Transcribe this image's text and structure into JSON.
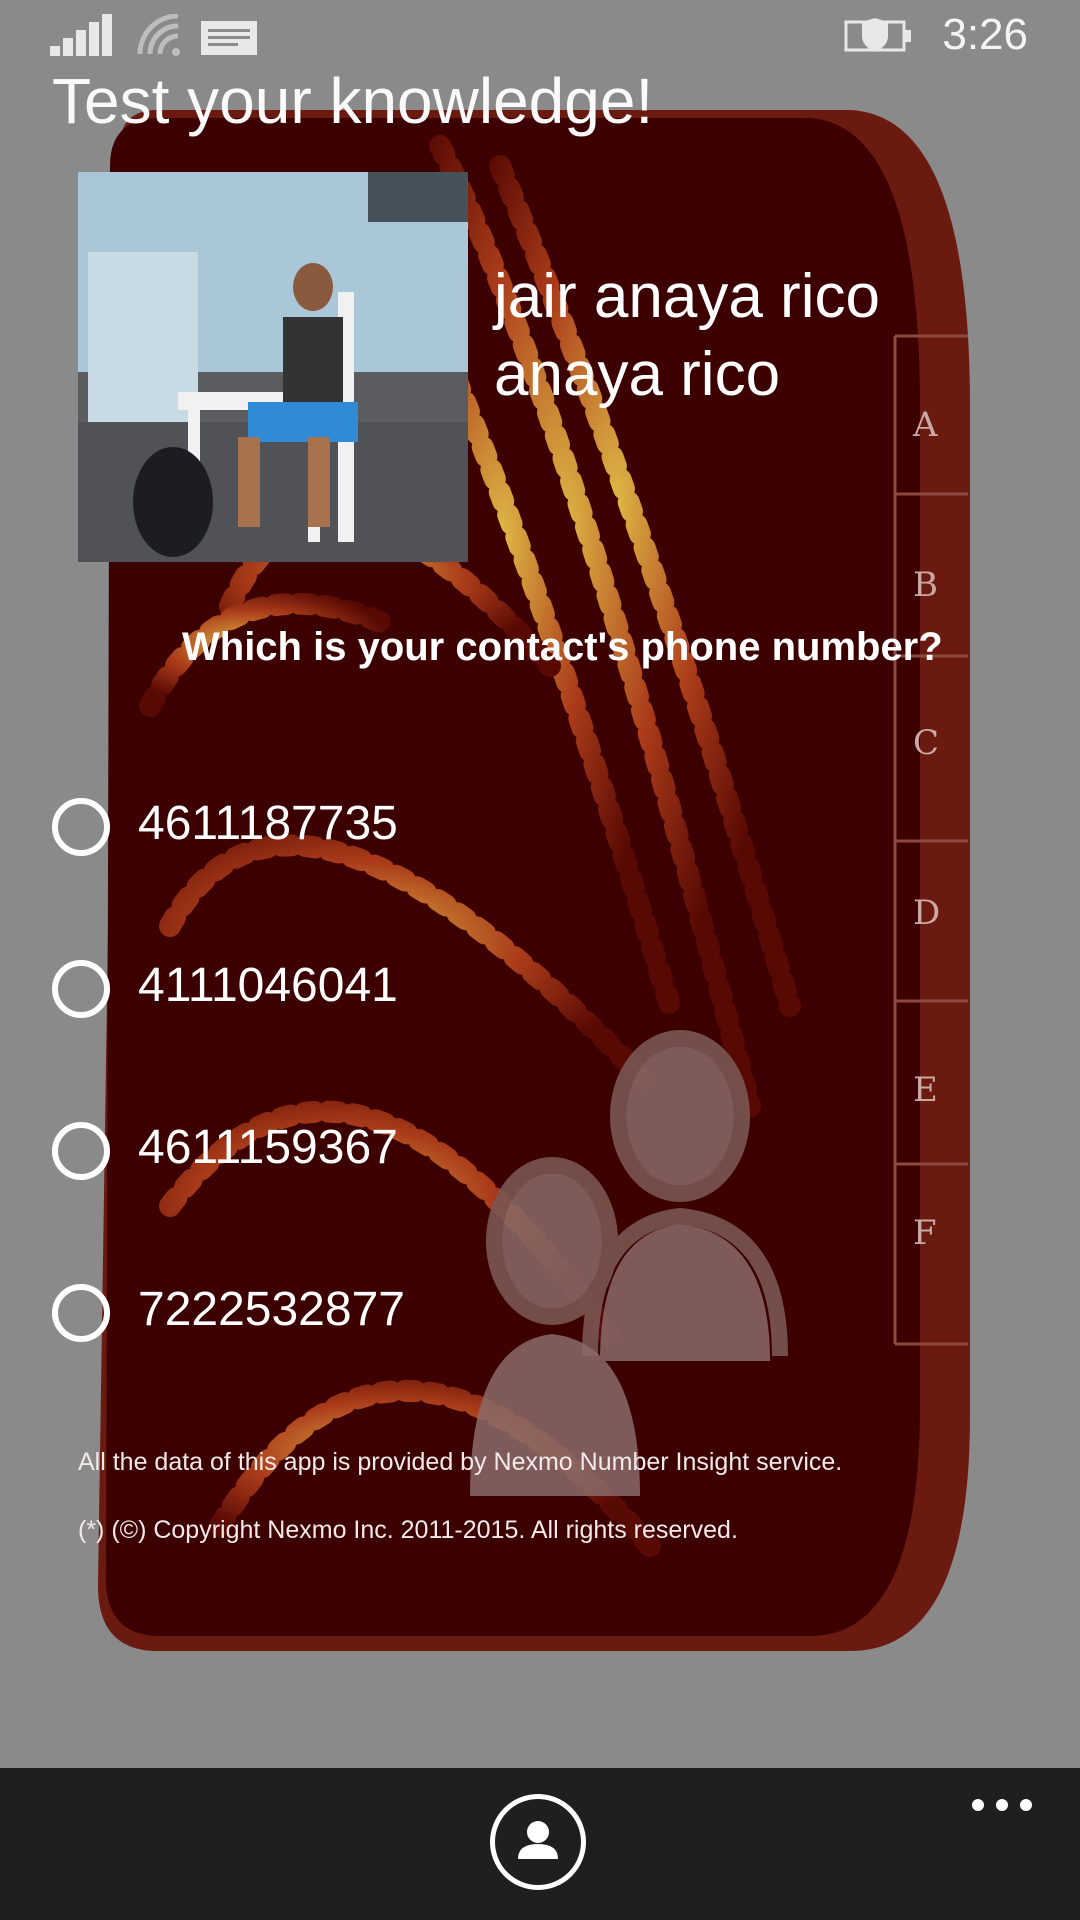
{
  "status_bar": {
    "time": "3:26",
    "icons": [
      "signal-strength-icon",
      "wifi-icon",
      "message-icon",
      "battery-saver-icon"
    ]
  },
  "page": {
    "title": "Test your knowledge!"
  },
  "contact": {
    "name_line1": "jair anaya rico",
    "name_line2": "anaya rico",
    "photo_alt": "contact-photo"
  },
  "quiz": {
    "question": "Which is your contact's phone number?",
    "options": [
      {
        "label": "4611187735",
        "selected": false
      },
      {
        "label": "4111046041",
        "selected": false
      },
      {
        "label": "4611159367",
        "selected": false
      },
      {
        "label": "7222532877",
        "selected": false
      }
    ]
  },
  "index_tabs": [
    "A",
    "B",
    "C",
    "D",
    "E",
    "F"
  ],
  "footer": {
    "line1": "All the data of this app is provided by Nexmo Number Insight service.",
    "line2": "(*) (©) Copyright Nexmo Inc. 2011-2015. All rights reserved."
  },
  "app_bar": {
    "primary_icon": "contact-icon",
    "more_icon": "more-options-icon"
  },
  "colors": {
    "background": "#8a8a8a",
    "book": "#3d0000",
    "app_bar": "#1f1f1f",
    "text": "#ffffff"
  }
}
